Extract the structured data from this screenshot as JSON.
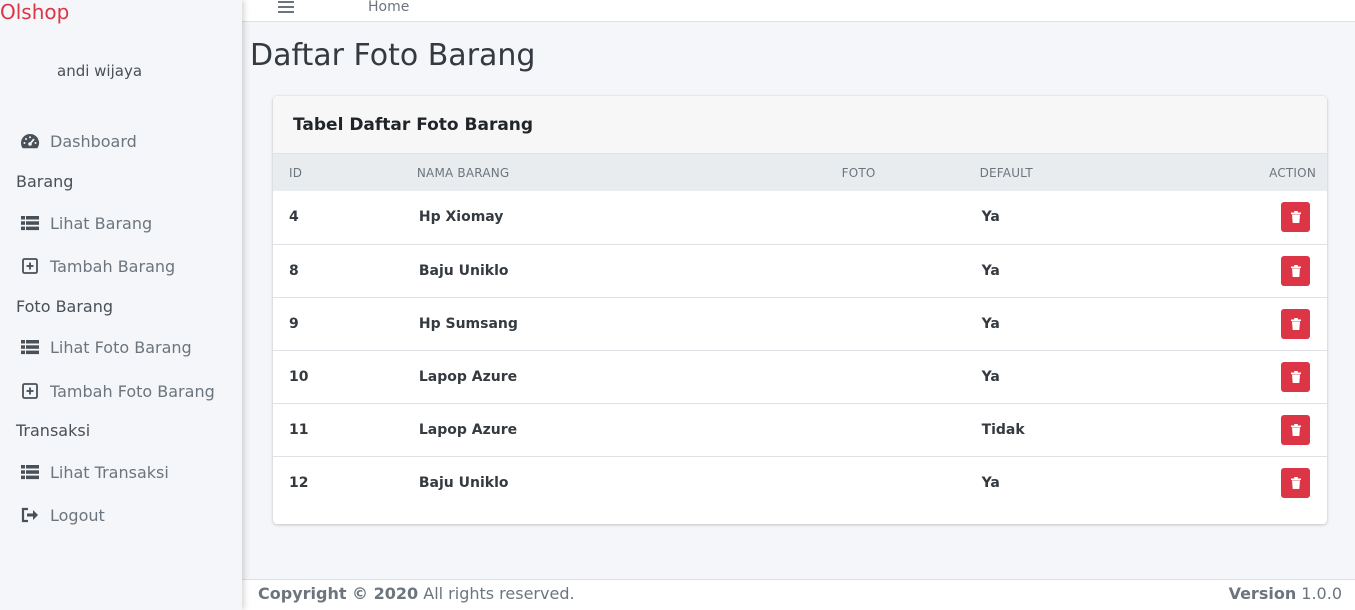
{
  "brand": "Olshop",
  "user": {
    "name": "andi wijaya"
  },
  "sidebar": {
    "dashboard": "Dashboard",
    "header_barang": "Barang",
    "lihat_barang": "Lihat Barang",
    "tambah_barang": "Tambah Barang",
    "header_foto": "Foto Barang",
    "lihat_foto": "Lihat Foto Barang",
    "tambah_foto": "Tambah Foto Barang",
    "header_transaksi": "Transaksi",
    "lihat_transaksi": "Lihat Transaksi",
    "logout": "Logout"
  },
  "topbar": {
    "home": "Home"
  },
  "page": {
    "title": "Daftar Foto Barang"
  },
  "card": {
    "title": "Tabel Daftar Foto Barang"
  },
  "table": {
    "headers": {
      "id": "ID",
      "name": "NAMA BARANG",
      "foto": "FOTO",
      "default": "DEFAULT",
      "action": "ACTION"
    },
    "rows": [
      {
        "id": "4",
        "name": "Hp Xiomay",
        "foto": "",
        "default": "Ya"
      },
      {
        "id": "8",
        "name": "Baju Uniklo",
        "foto": "",
        "default": "Ya"
      },
      {
        "id": "9",
        "name": "Hp Sumsang",
        "foto": "",
        "default": "Ya"
      },
      {
        "id": "10",
        "name": "Lapop Azure",
        "foto": "",
        "default": "Ya"
      },
      {
        "id": "11",
        "name": "Lapop Azure",
        "foto": "",
        "default": "Tidak"
      },
      {
        "id": "12",
        "name": "Baju Uniklo",
        "foto": "",
        "default": "Ya"
      }
    ]
  },
  "footer": {
    "copyright_bold": "Copyright © 2020",
    "copyright_rest": " All rights reserved.",
    "version_label": "Version",
    "version_value": " 1.0.0"
  },
  "colors": {
    "brand": "#dc3545",
    "danger": "#dc3545"
  },
  "icons": {
    "dashboard": "tachometer-icon",
    "list": "list-icon",
    "add": "plus-square-icon",
    "logout": "sign-out-icon",
    "delete": "trash-icon",
    "menu": "bars-icon"
  }
}
